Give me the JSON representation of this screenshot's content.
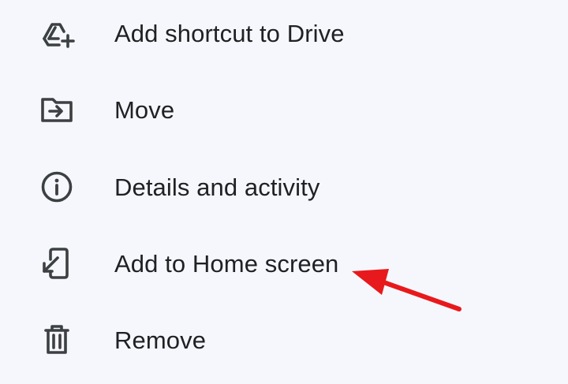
{
  "menu": {
    "items": [
      {
        "label": "Add shortcut to Drive",
        "icon": "add-to-drive-icon"
      },
      {
        "label": "Move",
        "icon": "move-folder-icon"
      },
      {
        "label": "Details and activity",
        "icon": "info-icon"
      },
      {
        "label": "Add to Home screen",
        "icon": "add-to-home-screen-icon"
      },
      {
        "label": "Remove",
        "icon": "trash-icon"
      }
    ]
  },
  "colors": {
    "background": "#f6f7fc",
    "text": "#202124",
    "icon": "#3c4043",
    "annotation_arrow": "#e8191c"
  }
}
